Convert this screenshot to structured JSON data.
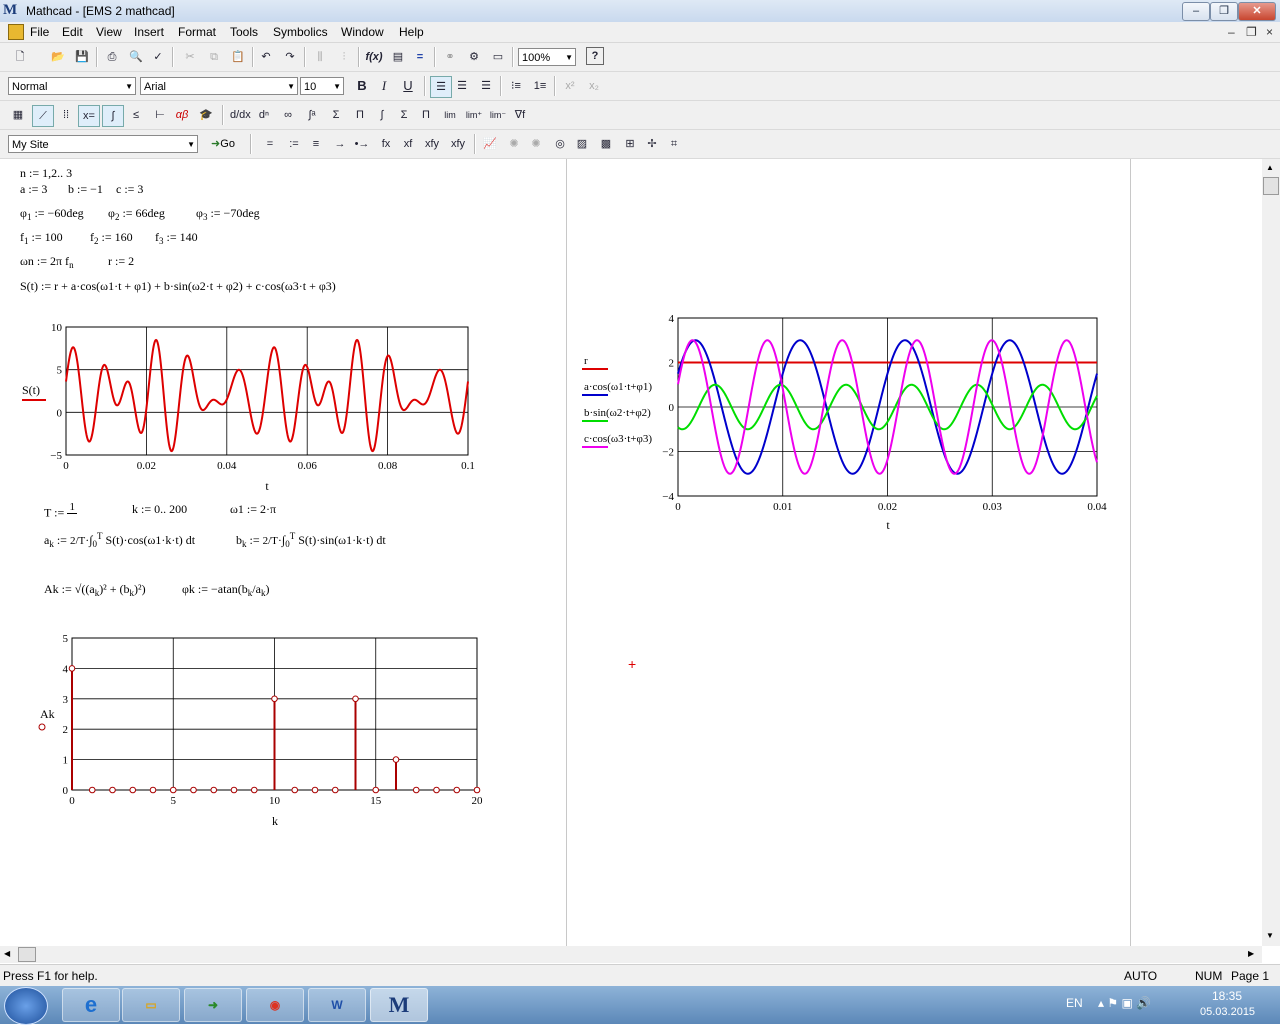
{
  "window": {
    "title": "Mathcad - [EMS 2 mathcad]",
    "app_logo": "M",
    "min": "‒",
    "max": "❐",
    "close": "✕"
  },
  "menu": {
    "items": [
      "File",
      "Edit",
      "View",
      "Insert",
      "Format",
      "Tools",
      "Symbolics",
      "Window",
      "Help"
    ],
    "mdi_min": "–",
    "mdi_restore": "❐",
    "mdi_close": "×"
  },
  "toolbar": {
    "zoom": "100%",
    "style": "Normal",
    "font": "Arial",
    "size": "10",
    "bold": "B",
    "italic": "I",
    "underline": "U",
    "site": "My Site",
    "go": "Go",
    "math_symbols": [
      "=",
      ":=",
      "≡",
      "→",
      "•→",
      "fx",
      "xf",
      "xfy",
      "xfy"
    ],
    "calc_icons": [
      "∫",
      "lim",
      "lim",
      "lim",
      "Σ",
      "Π",
      "d/dx"
    ],
    "num_percent": "100%"
  },
  "doc": {
    "line_n": "n := 1,2.. 3",
    "line_abc": [
      "a := 3",
      "b := −1",
      "c := 3"
    ],
    "phi": [
      "−60deg",
      "66deg",
      "−70deg"
    ],
    "freq": [
      "100",
      "160",
      "140"
    ],
    "omega": "ωn := 2π f",
    "r": "r := 2",
    "signal": "S(t) := r + a·cos(ω1·t + φ1) + b·sin(ω2·t + φ2) + c·cos(ω3·t + φ3)",
    "T_def": "T :=",
    "k_def": "k := 0.. 200",
    "w1_def": "ω1 := 2·",
    "ak_def": "S(t)·cos(ω1·k·t) dt",
    "bk_def": "S(t)·sin(ω1·k·t) dt",
    "Ak_def": "Ak",
    "phik_def": "φk := −atan"
  },
  "chart_data": [
    {
      "type": "line",
      "title": "",
      "xlabel": "t",
      "ylabel": "S(t)",
      "xlim": [
        0,
        0.1
      ],
      "ylim": [
        -5,
        10
      ],
      "x_ticks": [
        "0",
        "0.02",
        "0.04",
        "0.06",
        "0.08",
        "0.1"
      ],
      "y_ticks": [
        "10",
        "5",
        "0",
        "−5"
      ],
      "series": [
        {
          "name": "S(t)",
          "color": "#dd0000",
          "expression": "2 + 3cos(2π100t − 60°) − sin(2π160t + 66°) + 3cos(2π140t − 70°)"
        }
      ],
      "grid": true
    },
    {
      "type": "line",
      "title": "",
      "xlabel": "t",
      "ylabel": "",
      "xlim": [
        0,
        0.04
      ],
      "ylim": [
        -4,
        4
      ],
      "x_ticks": [
        "0",
        "0.01",
        "0.02",
        "0.03",
        "0.04"
      ],
      "y_ticks": [
        "4",
        "2",
        "0",
        "−2",
        "−4"
      ],
      "series": [
        {
          "name": "r",
          "color": "#dd0000",
          "expression": "2"
        },
        {
          "name": "a·cos(ω1·t+φ1)",
          "color": "#0000cc",
          "expression": "3cos(2π100t − 60°)"
        },
        {
          "name": "b·sin(ω2·t+φ2)",
          "color": "#00dd00",
          "expression": "−sin(2π160t + 66°)"
        },
        {
          "name": "c·cos(ω3·t+φ3)",
          "color": "#ee00ee",
          "expression": "3cos(2π140t − 70°)"
        }
      ],
      "grid": true,
      "legend": "left"
    },
    {
      "type": "bar",
      "title": "",
      "xlabel": "k",
      "ylabel": "Ak",
      "xlim": [
        0,
        20
      ],
      "ylim": [
        0,
        5
      ],
      "x_ticks": [
        "0",
        "5",
        "10",
        "15",
        "20"
      ],
      "y_ticks": [
        "5",
        "4",
        "3",
        "2",
        "1",
        "0"
      ],
      "x": [
        0,
        1,
        2,
        3,
        4,
        5,
        6,
        7,
        8,
        9,
        10,
        11,
        12,
        13,
        14,
        15,
        16,
        17,
        18,
        19,
        20
      ],
      "values": [
        4,
        0,
        0,
        0,
        0,
        0,
        0,
        0,
        0,
        0,
        3,
        0,
        0,
        0,
        3,
        0,
        1,
        0,
        0,
        0,
        0
      ],
      "color": "#aa0000",
      "grid": true
    }
  ],
  "status": {
    "help": "Press F1 for help.",
    "mode": "AUTO",
    "num": "NUM",
    "page": "Page 1"
  },
  "taskbar": {
    "lang": "EN",
    "time": "18:35",
    "date": "05.03.2015"
  }
}
